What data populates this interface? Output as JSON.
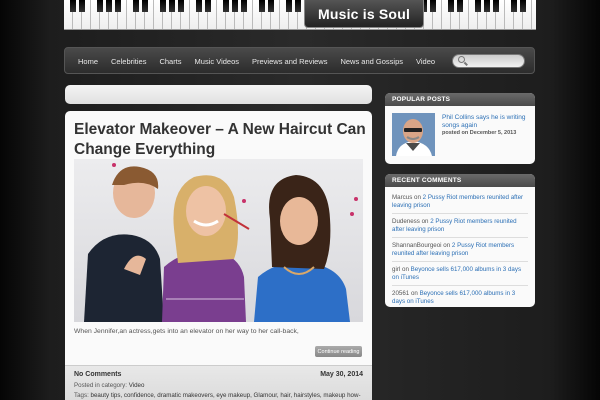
{
  "header": {
    "logo_text": "Music is Soul"
  },
  "nav": {
    "items": [
      "Home",
      "Celebrities",
      "Charts",
      "Music Videos",
      "Previews and Reviews",
      "News and Gossips",
      "Video"
    ]
  },
  "search": {
    "placeholder": "",
    "icon": "search-icon"
  },
  "post": {
    "title": "Elevator Makeover – A New Haircut Can Change Everything",
    "excerpt": "When Jennifer,an actress,gets into an elevator on her way to her call-back,",
    "continue_label": "Continue reading",
    "comments_label": "No Comments",
    "date": "May 30, 2014",
    "category_prefix": "Posted in category:",
    "category": "Video",
    "tags_prefix": "Tags:",
    "tags": "beauty tips, confidence, dramatic makeovers, eye makeup, Glamour, hair, hairstyles, makeup how-"
  },
  "popular_posts": {
    "title": "POPULAR POSTS",
    "items": [
      {
        "link": "Phil Collins says he is writing songs again",
        "date": "posted on December 5, 2013"
      }
    ]
  },
  "recent_comments": {
    "title": "RECENT COMMENTS",
    "items": [
      {
        "author": "Marcus",
        "on": "on",
        "link": "2 Pussy Riot members reunited after leaving prison"
      },
      {
        "author": "Dudeness",
        "on": "on",
        "link": "2 Pussy Riot members reunited after leaving prison"
      },
      {
        "author": "ShannanBourgeoi",
        "on": "on",
        "link": "2 Pussy Riot members reunited after leaving prison"
      },
      {
        "author": "girl",
        "on": "on",
        "link": "Beyonce sells 617,000 albums in 3 days on iTunes"
      },
      {
        "author": "20561",
        "on": "on",
        "link": "Beyonce sells 617,000 albums in 3 days on iTunes"
      }
    ]
  }
}
